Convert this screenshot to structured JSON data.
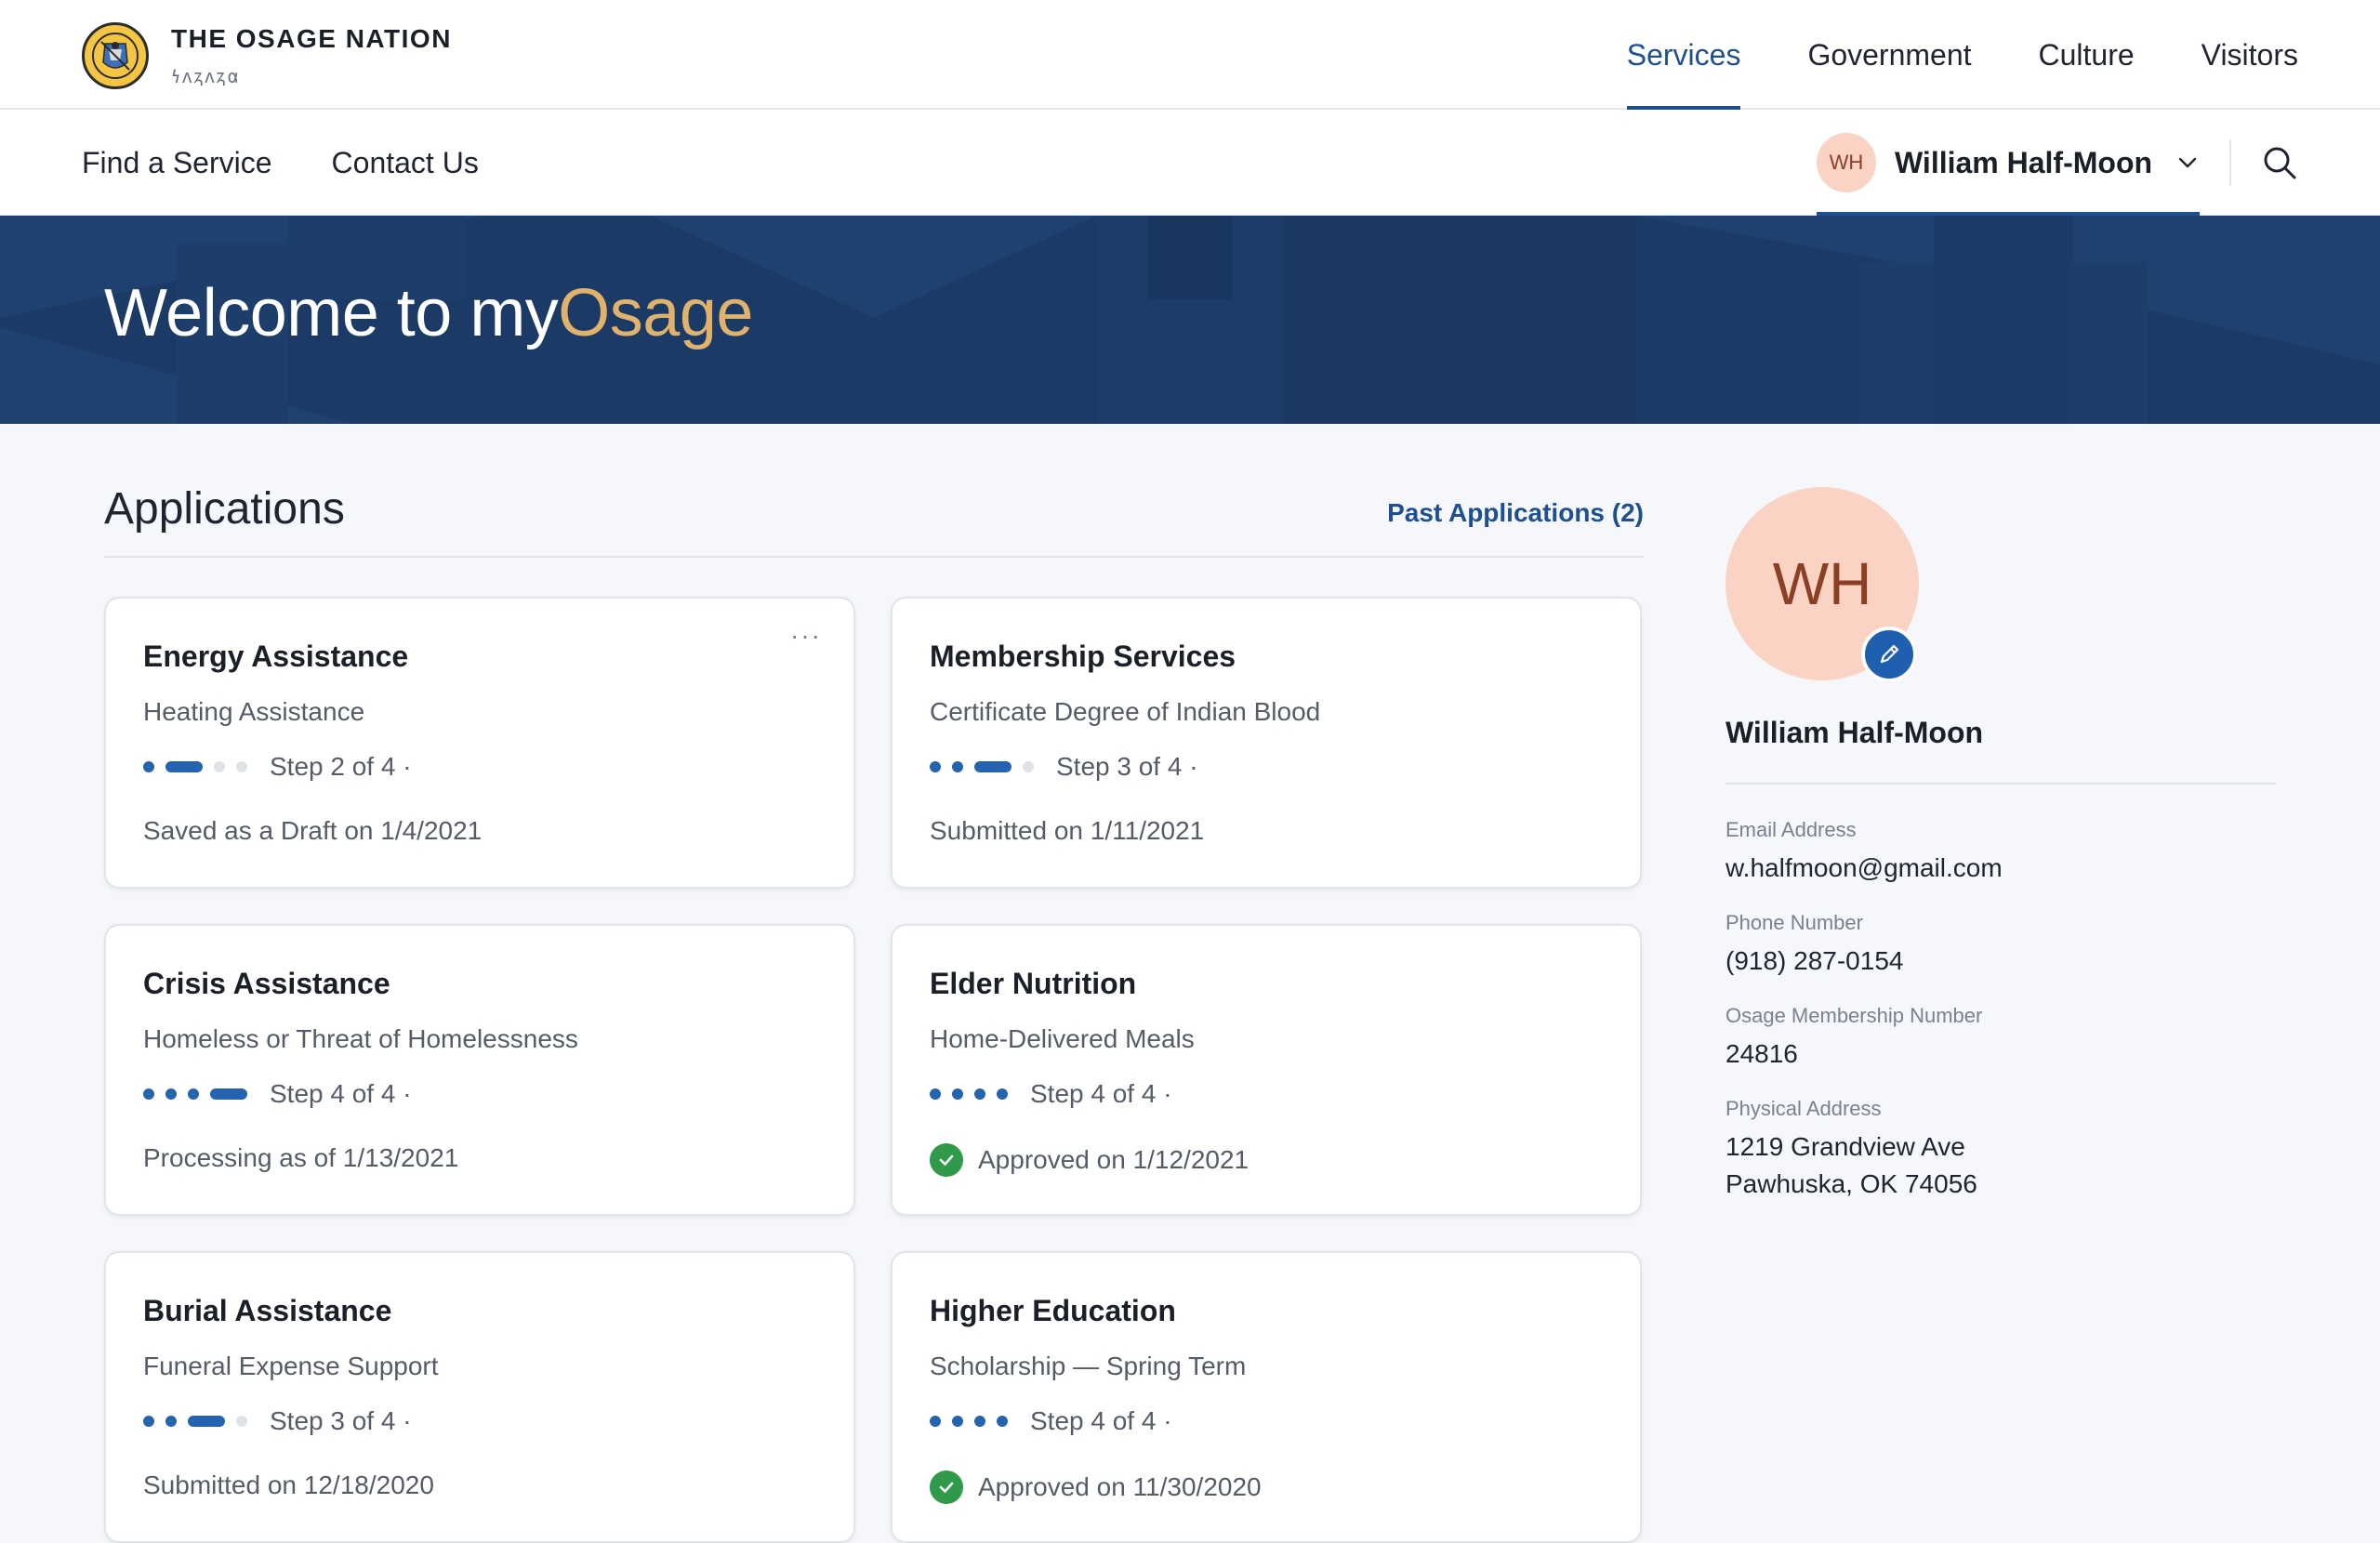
{
  "brand": {
    "title": "THE OSAGE NATION",
    "subtitle": "𐓏𐓘𐓻𐓘𐓻𐓟"
  },
  "main_nav": [
    {
      "label": "Services",
      "active": true
    },
    {
      "label": "Government",
      "active": false
    },
    {
      "label": "Culture",
      "active": false
    },
    {
      "label": "Visitors",
      "active": false
    }
  ],
  "sub_nav": [
    {
      "label": "Find a Service"
    },
    {
      "label": "Contact Us"
    }
  ],
  "user": {
    "initials": "WH",
    "name": "William Half-Moon"
  },
  "hero": {
    "title_prefix": "Welcome to my",
    "title_accent": "Osage"
  },
  "applications": {
    "title": "Applications",
    "past_link": "Past Applications (2)",
    "cards": [
      {
        "title": "Energy Assistance",
        "subtitle": "Heating Assistance",
        "step": 2,
        "total": 4,
        "step_text": "Step 2 of 4 ·",
        "status": "Saved as a Draft on 1/4/2021",
        "approved": false,
        "menu": "···"
      },
      {
        "title": "Membership Services",
        "subtitle": "Certificate Degree of Indian Blood",
        "step": 3,
        "total": 4,
        "step_text": "Step 3 of 4 ·",
        "status": "Submitted on 1/11/2021",
        "approved": false
      },
      {
        "title": "Crisis Assistance",
        "subtitle": "Homeless or Threat of Homelessness",
        "step": 4,
        "total": 4,
        "step_text": "Step 4 of 4 ·",
        "status": "Processing as of 1/13/2021",
        "approved": false
      },
      {
        "title": "Elder Nutrition",
        "subtitle": "Home-Delivered Meals",
        "step": 4,
        "total": 4,
        "step_text": "Step 4 of 4 ·",
        "status": "Approved on 1/12/2021",
        "approved": true
      },
      {
        "title": "Burial Assistance",
        "subtitle": "Funeral Expense Support",
        "step": 3,
        "total": 4,
        "step_text": "Step 3 of 4 ·",
        "status": "Submitted on 12/18/2020",
        "approved": false
      },
      {
        "title": "Higher Education",
        "subtitle": "Scholarship — Spring Term",
        "step": 4,
        "total": 4,
        "step_text": "Step 4 of 4 ·",
        "status": "Approved on 11/30/2020",
        "approved": true
      }
    ]
  },
  "profile": {
    "initials": "WH",
    "name": "William Half-Moon",
    "fields": [
      {
        "label": "Email Address",
        "value": "w.halfmoon@gmail.com"
      },
      {
        "label": "Phone Number",
        "value": "(918) 287-0154"
      },
      {
        "label": "Osage Membership Number",
        "value": "24816"
      },
      {
        "label": "Physical Address",
        "value": "1219 Grandview Ave",
        "value2": "Pawhuska, OK 74056"
      }
    ]
  },
  "colors": {
    "accent": "#1d4f91",
    "hero_bg": "#1b3a66",
    "hero_accent": "#e0b26c",
    "avatar_bg": "#fbd3c4",
    "success": "#2e9a4a"
  }
}
